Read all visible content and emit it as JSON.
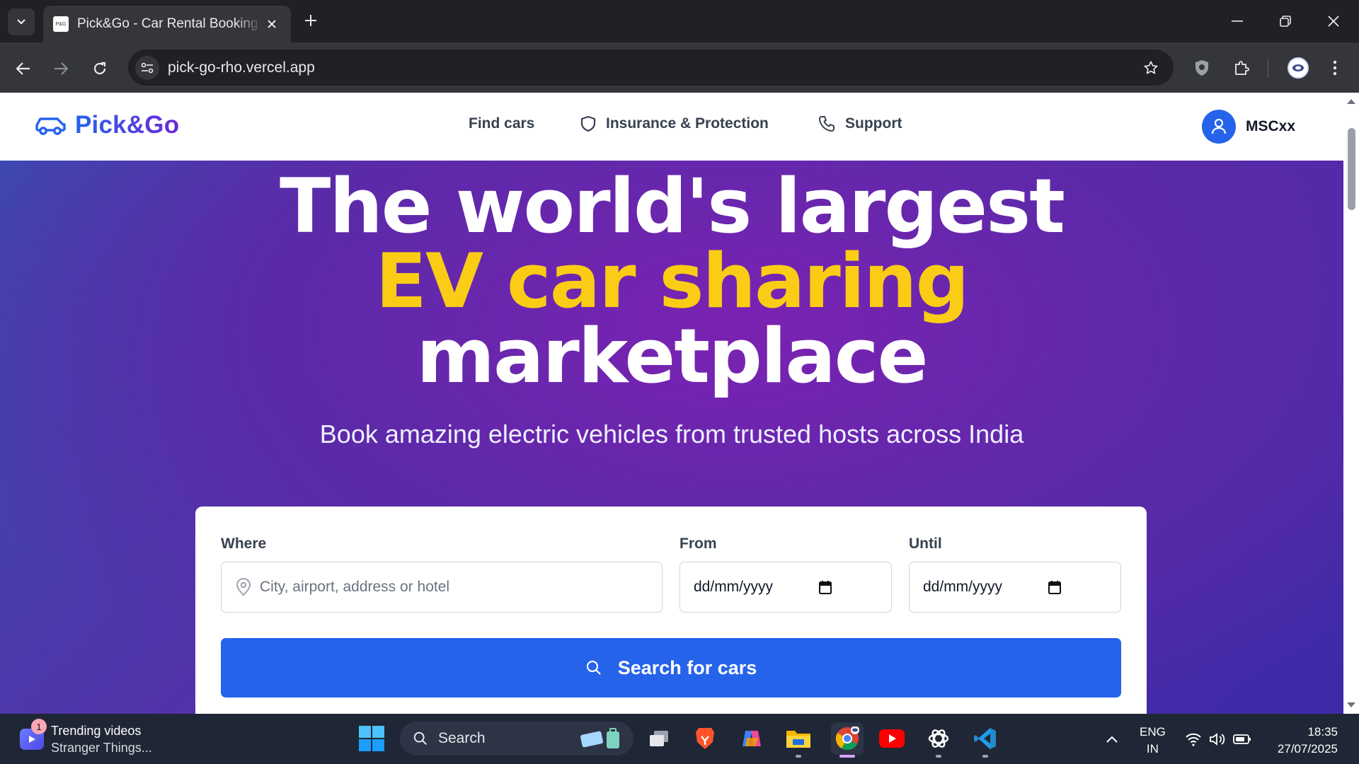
{
  "browser": {
    "tab_title": "Pick&Go - Car Rental Booking Platform",
    "tab_favicon_text": "P&G",
    "url": "pick-go-rho.vercel.app"
  },
  "site": {
    "brand": "Pick&Go",
    "nav": {
      "find_cars": "Find cars",
      "insurance": "Insurance & Protection",
      "support": "Support"
    },
    "user_name": "MSCxx"
  },
  "hero": {
    "line1": "The world's largest",
    "line2": "EV car sharing",
    "line3": "marketplace",
    "subtitle": "Book amazing electric vehicles from trusted hosts across India",
    "accent_color": "#facc15"
  },
  "search": {
    "where_label": "Where",
    "where_placeholder": "City, airport, address or hotel",
    "from_label": "From",
    "from_value": "dd/mm/yyyy",
    "until_label": "Until",
    "until_value": "dd/mm/yyyy",
    "button_label": "Search for cars",
    "button_color": "#2563eb"
  },
  "taskbar": {
    "widget_title": "Trending videos",
    "widget_subtitle": "Stranger Things...",
    "widget_badge": "1",
    "search_label": "Search",
    "lang_line1": "ENG",
    "lang_line2": "IN",
    "time": "18:35",
    "date": "27/07/2025"
  }
}
